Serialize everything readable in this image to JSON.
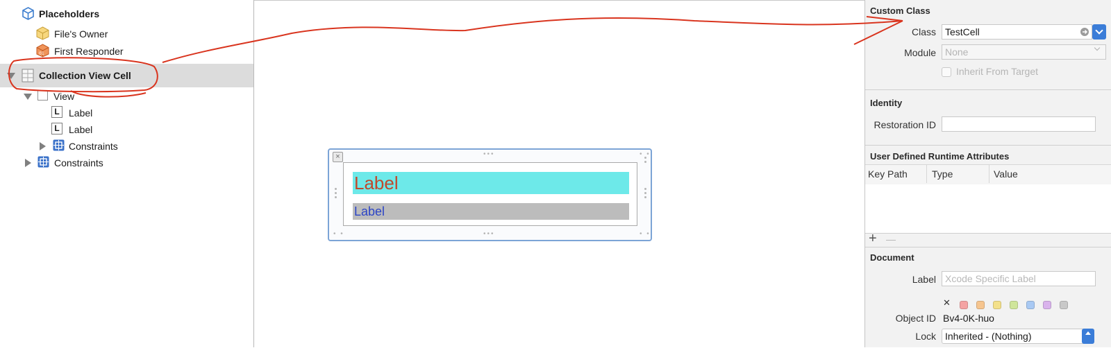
{
  "outline": {
    "placeholders": "Placeholders",
    "files_owner": "File's Owner",
    "first_responder": "First Responder",
    "collection_view_cell": "Collection View Cell",
    "view": "View",
    "label_a": "Label",
    "label_b": "Label",
    "inner_constraints": "Constraints",
    "outer_constraints": "Constraints"
  },
  "canvas": {
    "label1": "Label",
    "label2": "Label"
  },
  "inspector": {
    "custom_class": {
      "title": "Custom Class",
      "class_label": "Class",
      "class_value": "TestCell",
      "module_label": "Module",
      "module_value": "None",
      "inherit_label": "Inherit From Target"
    },
    "identity": {
      "title": "Identity",
      "restoration_label": "Restoration ID",
      "restoration_value": ""
    },
    "runtime": {
      "title": "User Defined Runtime Attributes",
      "columns": [
        "Key Path",
        "Type",
        "Value"
      ],
      "add": "+",
      "remove": "—"
    },
    "document": {
      "title": "Document",
      "label_label": "Label",
      "label_placeholder": "Xcode Specific Label",
      "clear": "✕",
      "object_id_label": "Object ID",
      "object_id_value": "Bv4-0K-huo",
      "lock_label": "Lock",
      "lock_value": "Inherited - (Nothing)"
    }
  },
  "colors": {
    "annotation": "#d9341e",
    "label1_bg": "#6de9e9",
    "label1_text": "#c0492c",
    "label2_bg": "#bcbcbc",
    "label2_text": "#2c45c6",
    "accent": "#3b7dd8",
    "swatches": [
      "#f4a3a3",
      "#f6c58f",
      "#f3e08a",
      "#cfe59a",
      "#a9c9f3",
      "#d9b3ec",
      "#c8c8c8"
    ]
  }
}
